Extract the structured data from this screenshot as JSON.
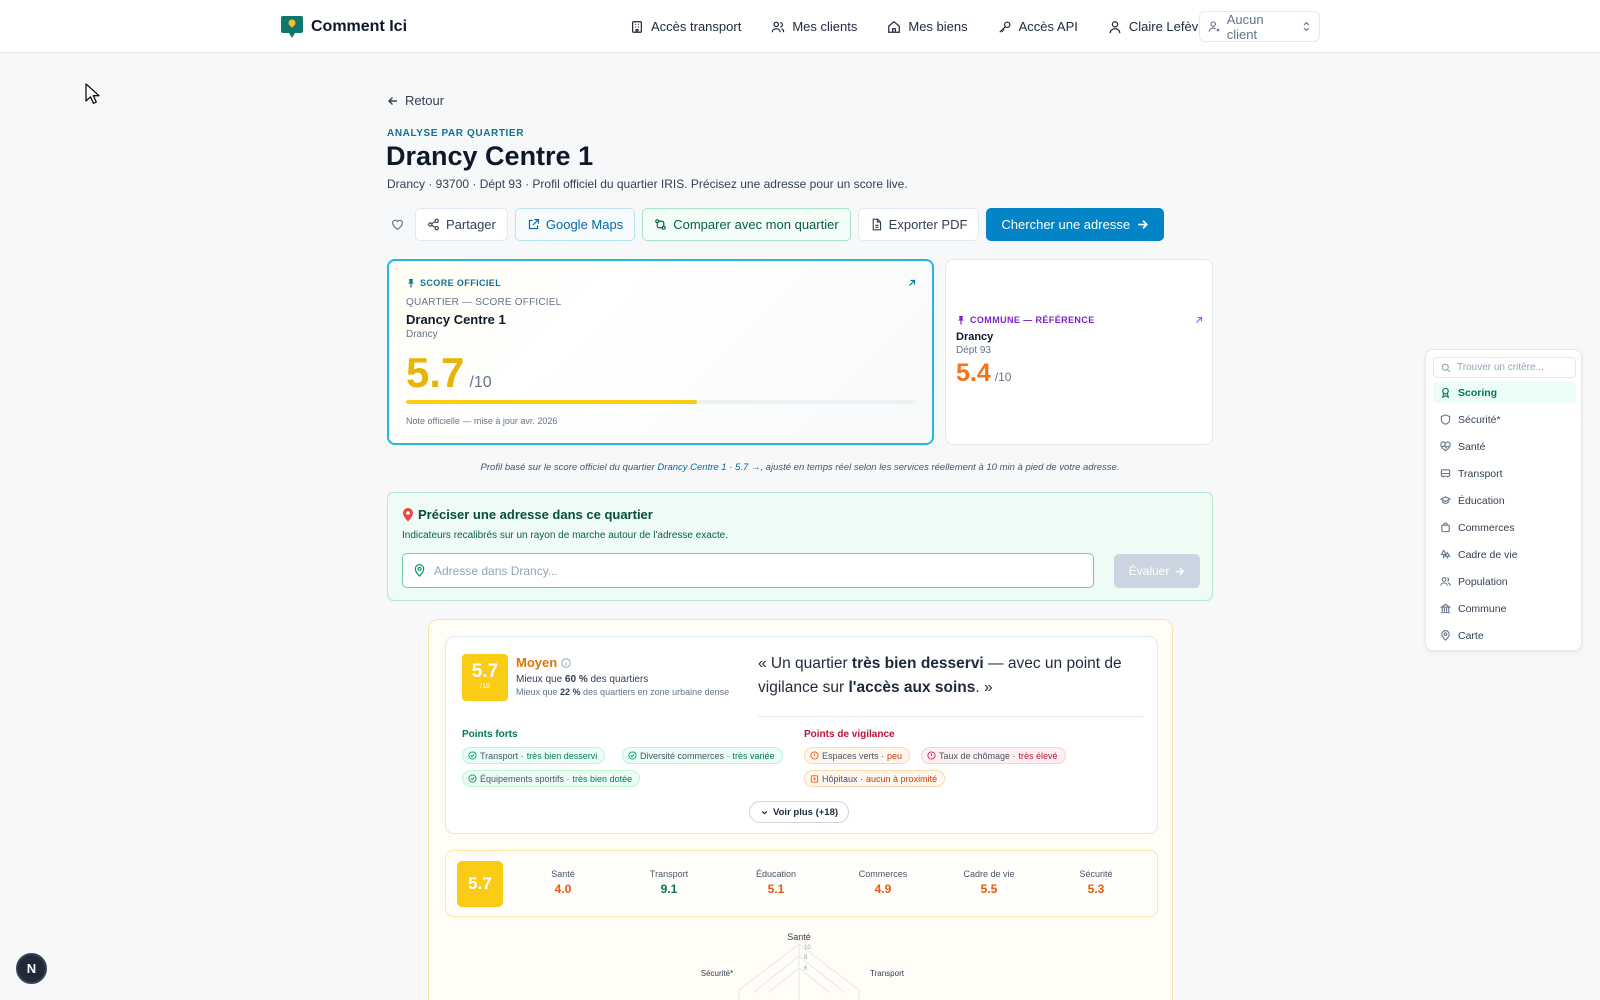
{
  "header": {
    "brand": "Comment Ici",
    "nav": [
      "Accès transport",
      "Mes clients",
      "Mes biens",
      "Accès API",
      "Claire Lefèvre"
    ],
    "client_select": "Aucun client"
  },
  "page": {
    "back": "Retour",
    "kicker": "ANALYSE PAR QUARTIER",
    "title": "Drancy Centre 1",
    "subtitle": "Drancy · 93700 · Dépt 93 · Profil officiel du quartier IRIS. Précisez une adresse pour un score live."
  },
  "actions": {
    "share": "Partager",
    "maps": "Google Maps",
    "compare": "Comparer avec mon quartier",
    "export": "Exporter PDF",
    "search": "Chercher une adresse"
  },
  "official_card": {
    "label": "SCORE OFFICIEL",
    "sub": "QUARTIER — SCORE OFFICIEL",
    "name": "Drancy Centre 1",
    "commune": "Drancy",
    "score": "5.7",
    "denom": "/10",
    "progress": 0.57,
    "note": "Note officielle — mise à jour avr. 2026"
  },
  "reference_card": {
    "label": "COMMUNE — RÉFÉRENCE",
    "name": "Drancy",
    "dept": "Dépt 93",
    "score": "5.4",
    "denom": "/10"
  },
  "caption": {
    "before": "Profil basé sur le score officiel du quartier ",
    "link": "Drancy Centre 1 · 5.7 →",
    "after": ", ajusté en temps réel selon les services réellement à 10 min à pied de votre adresse."
  },
  "address": {
    "title": "Préciser une adresse dans ce quartier",
    "desc": "Indicateurs recalibrés sur un rayon de marche autour de l'adresse exacte.",
    "placeholder": "Adresse dans Drancy...",
    "button": "Évaluer"
  },
  "summary": {
    "score": "5.7",
    "denom": "/10",
    "level": "Moyen",
    "better_prefix": "Mieux que ",
    "better_pct": "60 %",
    "better_suffix": " des quartiers",
    "better2_prefix": "Mieux que ",
    "better2_pct": "22 %",
    "better2_suffix": " des quartiers en zone urbaine dense",
    "quote_open": "« Un quartier ",
    "quote_b1": "très bien desservi",
    "quote_mid": " — avec un point de vigilance sur ",
    "quote_b2": "l'accès aux soins",
    "quote_close": ". »",
    "strengths_title": "Points forts",
    "strengths": [
      {
        "label": "Transport · ",
        "qual": "très bien desservi"
      },
      {
        "label": "Diversité commerces · ",
        "qual": "très variée"
      },
      {
        "label": "Équipements sportifs · ",
        "qual": "très bien dotée"
      }
    ],
    "watch_title": "Points de vigilance",
    "watch": [
      {
        "label": "Espaces verts · ",
        "qual": "peu"
      },
      {
        "label": "Taux de chômage · ",
        "qual": "très élevé"
      },
      {
        "label": "Hôpitaux · ",
        "qual": "aucun à proximité"
      }
    ],
    "more": "Voir plus (+18)"
  },
  "scorebar": {
    "score": "5.7",
    "items": [
      {
        "label": "Santé",
        "value": "4.0"
      },
      {
        "label": "Transport",
        "value": "9.1"
      },
      {
        "label": "Éducation",
        "value": "5.1"
      },
      {
        "label": "Commerces",
        "value": "4.9"
      },
      {
        "label": "Cadre de vie",
        "value": "5.5"
      },
      {
        "label": "Sécurité",
        "value": "5.3"
      }
    ]
  },
  "radar": {
    "labels": [
      "Santé",
      "Sécurité*",
      "Transport"
    ],
    "ticks": [
      "10",
      "8",
      "6"
    ]
  },
  "sidenav": {
    "placeholder": "Trouver un critère...",
    "items": [
      "Scoring",
      "Sécurité*",
      "Santé",
      "Transport",
      "Éducation",
      "Commerces",
      "Cadre de vie",
      "Population",
      "Commune",
      "Carte"
    ]
  },
  "n_badge": "N",
  "colors": {
    "primary": "#0284c7",
    "score_yellow": "#facc15",
    "score_orange": "#f97316",
    "official_border": "#22b8dc"
  }
}
